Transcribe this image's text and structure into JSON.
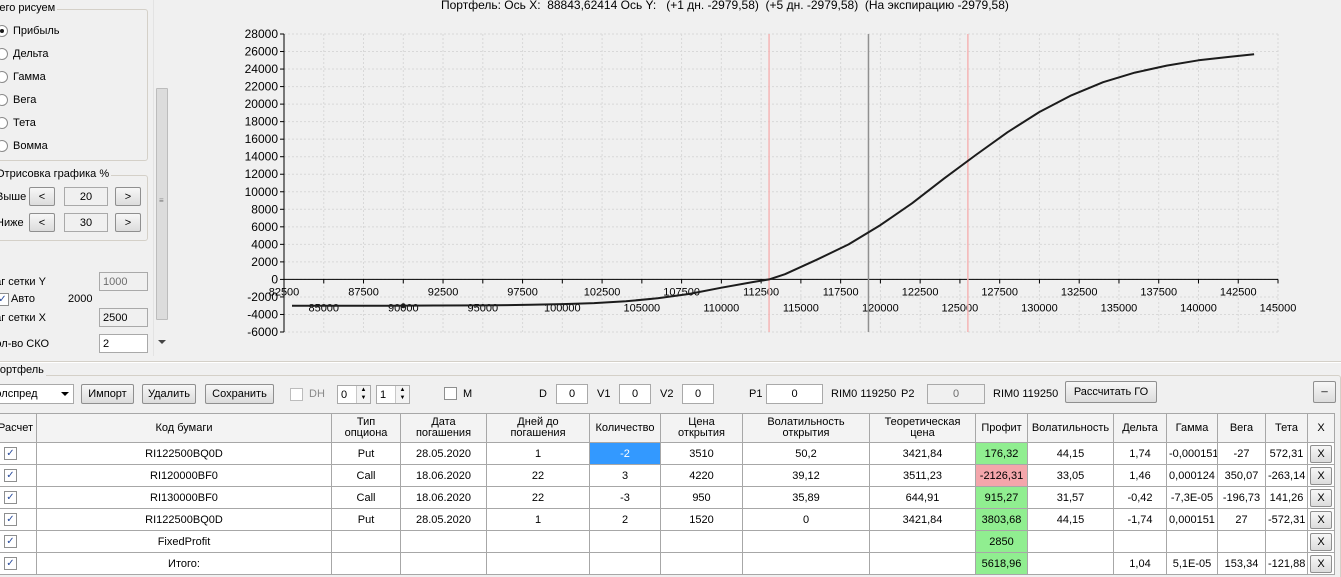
{
  "sidebar": {
    "draw_group_label": "Чего рисуем",
    "draw_options": [
      {
        "label": "Прибыль",
        "selected": true
      },
      {
        "label": "Дельта",
        "selected": false
      },
      {
        "label": "Гамма",
        "selected": false
      },
      {
        "label": "Вега",
        "selected": false
      },
      {
        "label": "Тета",
        "selected": false
      },
      {
        "label": "Вомма",
        "selected": false
      }
    ],
    "render_group_label": "Отрисовка графика %",
    "above_label": "Выше",
    "above_value": "20",
    "below_label": "Ниже",
    "below_value": "30",
    "less_btn": "<",
    "more_btn": ">",
    "grid_y_label": "Шаг сетки Y",
    "grid_y_value": "1000",
    "auto_label": "Авто",
    "auto_checked": true,
    "auto_value": "2000",
    "grid_x_label": "Шаг сетки X",
    "grid_x_value": "2500",
    "sko_label": "Кол-во СКО",
    "sko_value": "2"
  },
  "chart": {
    "header": "Портфель: Ось X:  88843,62414 Ось Y:   (+1 дн. -2979,58)  (+5 дн. -2979,58)  (На экспирацию -2979,58)"
  },
  "chart_data": {
    "type": "line",
    "x_ticks_upper": [
      "82500",
      "87500",
      "92500",
      "97500",
      "102500",
      "107500",
      "112500",
      "117500",
      "122500",
      "127500",
      "132500",
      "137500",
      "142500"
    ],
    "x_ticks_lower": [
      "85000",
      "90000",
      "95000",
      "100000",
      "105000",
      "110000",
      "115000",
      "120000",
      "125000",
      "130000",
      "135000",
      "140000",
      "145000"
    ],
    "y_ticks": [
      "28000",
      "26000",
      "24000",
      "22000",
      "20000",
      "18000",
      "16000",
      "14000",
      "12000",
      "10000",
      "8000",
      "6000",
      "4000",
      "2000",
      "0",
      "-2000",
      "-4000",
      "-6000"
    ],
    "xlim": [
      82500,
      145000
    ],
    "ylim": [
      -6000,
      28000
    ],
    "grid": true,
    "series": [
      {
        "x": [
          83000,
          86000,
          89000,
          92000,
          95000,
          98000,
          100000,
          102000,
          104000,
          106000,
          108000,
          110000,
          112000,
          113000,
          114000,
          116000,
          118000,
          120000,
          122000,
          124000,
          126000,
          128000,
          130000,
          132000,
          134000,
          136000,
          138000,
          140000,
          142000,
          143500
        ],
        "y": [
          -3000,
          -3000,
          -3000,
          -2980,
          -2960,
          -2900,
          -2820,
          -2700,
          -2500,
          -2150,
          -1650,
          -950,
          -300,
          0,
          600,
          2250,
          4000,
          6200,
          8700,
          11500,
          14200,
          16800,
          19100,
          21000,
          22500,
          23600,
          24400,
          25000,
          25400,
          25700
        ]
      }
    ],
    "markers": [
      {
        "x": 90000,
        "y": -3000
      }
    ],
    "vlines": [
      {
        "x": 113000,
        "color": "#f5b5b5"
      },
      {
        "x": 119250,
        "color": "#909090"
      },
      {
        "x": 125500,
        "color": "#f5b5b5"
      }
    ],
    "colors": {
      "line": "#1c1c1c",
      "grid": "#d8d8d8"
    }
  },
  "portfolio": {
    "group_label": "Портфель",
    "combo_value": "Колспред",
    "import_btn": "Импорт",
    "delete_btn": "Удалить",
    "save_btn": "Сохранить",
    "dh_label": "DH",
    "dh_checked": false,
    "spin1": "0",
    "spin2": "1",
    "m_label": "M",
    "m_checked": false,
    "d_label": "D",
    "d_value": "0",
    "v1_label": "V1",
    "v1_value": "0",
    "v2_label": "V2",
    "v2_value": "0",
    "p1_label": "P1",
    "p1_value": "0",
    "rim1": "RIM0 119250",
    "p2_label": "P2",
    "p2_value": "0",
    "rim2": "RIM0 119250",
    "calc_btn": "Рассчитать ГО",
    "min_btn": "_"
  },
  "table": {
    "headers": [
      "Расчет",
      "Код бумаги",
      "Тип\nопциона",
      "Дата\nпогашения",
      "Дней до\nпогашения",
      "Количество",
      "Цена\nоткрытия",
      "Волатильность\nоткрытия",
      "Теоретическая\nцена",
      "Профит",
      "Волатильность",
      "Дельта",
      "Гамма",
      "Вега",
      "Тета",
      "X"
    ],
    "rows": [
      {
        "checked": true,
        "code": "RI122500BQ0D",
        "type": "Put",
        "date": "28.05.2020",
        "days": "1",
        "qty": "-2",
        "price": "3510",
        "vol_open": "50,2",
        "theo": "3421,84",
        "profit": "176,32",
        "profit_color": "green",
        "vol": "44,15",
        "delta": "1,74",
        "gamma": "-0,000151",
        "vega": "-27",
        "theta": "572,31",
        "x": "X",
        "qty_selected": true
      },
      {
        "checked": true,
        "code": "RI120000BF0",
        "type": "Call",
        "date": "18.06.2020",
        "days": "22",
        "qty": "3",
        "price": "4220",
        "vol_open": "39,12",
        "theo": "3511,23",
        "profit": "-2126,31",
        "profit_color": "red",
        "vol": "33,05",
        "delta": "1,46",
        "gamma": "0,000124",
        "vega": "350,07",
        "theta": "-263,14",
        "x": "X",
        "qty_selected": false
      },
      {
        "checked": true,
        "code": "RI130000BF0",
        "type": "Call",
        "date": "18.06.2020",
        "days": "22",
        "qty": "-3",
        "price": "950",
        "vol_open": "35,89",
        "theo": "644,91",
        "profit": "915,27",
        "profit_color": "green",
        "vol": "31,57",
        "delta": "-0,42",
        "gamma": "-7,3E-05",
        "vega": "-196,73",
        "theta": "141,26",
        "x": "X",
        "qty_selected": false
      },
      {
        "checked": true,
        "code": "RI122500BQ0D",
        "type": "Put",
        "date": "28.05.2020",
        "days": "1",
        "qty": "2",
        "price": "1520",
        "vol_open": "0",
        "theo": "3421,84",
        "profit": "3803,68",
        "profit_color": "green",
        "vol": "44,15",
        "delta": "-1,74",
        "gamma": "0,000151",
        "vega": "27",
        "theta": "-572,31",
        "x": "X",
        "qty_selected": false
      },
      {
        "checked": true,
        "code": "FixedProfit",
        "type": "",
        "date": "",
        "days": "",
        "qty": "",
        "price": "",
        "vol_open": "",
        "theo": "",
        "profit": "2850",
        "profit_color": "green",
        "vol": "",
        "delta": "",
        "gamma": "",
        "vega": "",
        "theta": "",
        "x": "X",
        "qty_selected": false
      },
      {
        "checked": true,
        "code": "Итого:",
        "type": "",
        "date": "",
        "days": "",
        "qty": "",
        "price": "",
        "vol_open": "",
        "theo": "",
        "profit": "5618,96",
        "profit_color": "green",
        "vol": "",
        "delta": "1,04",
        "gamma": "5,1E-05",
        "vega": "153,34",
        "theta": "-121,88",
        "x": "X",
        "qty_selected": false
      }
    ]
  }
}
